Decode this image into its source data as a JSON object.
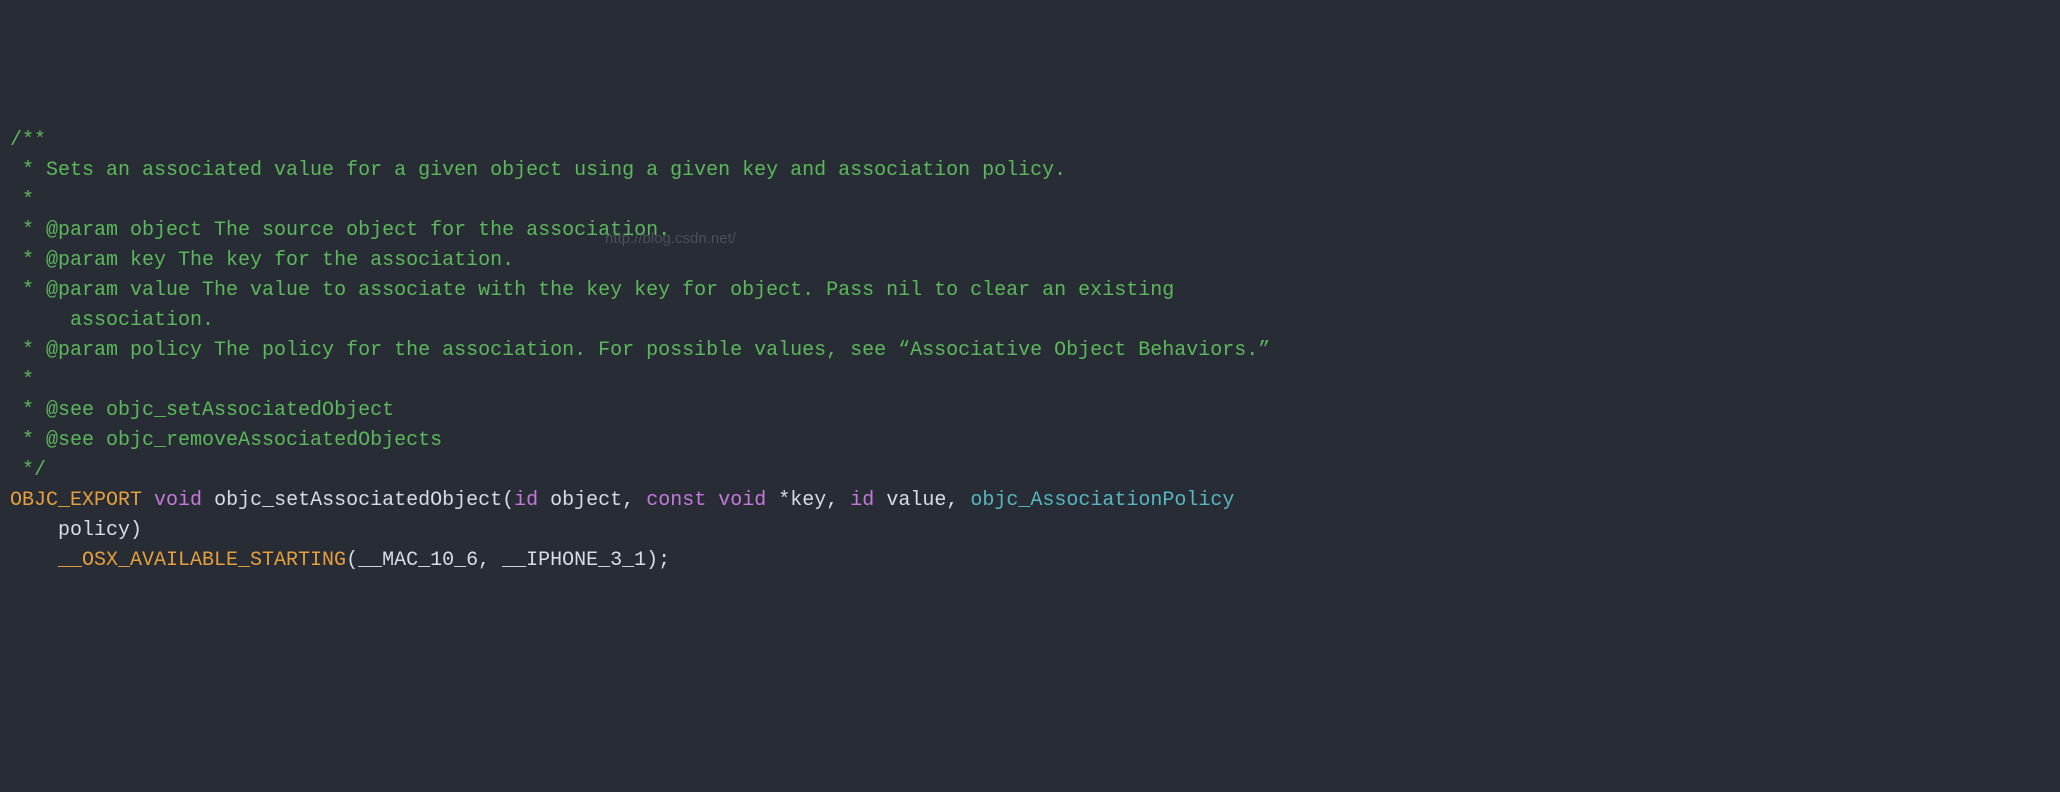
{
  "code": {
    "line1": "/**",
    "line2_prefix": " * ",
    "line2_text": "Sets an associated value for a given object using a given key and association policy.",
    "line3": " *",
    "line4_prefix": " * ",
    "line4_text": "@param object The source object for the association.",
    "line5_prefix": " * ",
    "line5_text": "@param key The key for the association.",
    "line6_prefix": " * ",
    "line6_text": "@param value The value to associate with the key key for object. Pass nil to clear an existing",
    "line7_prefix": "     ",
    "line7_text": "association.",
    "line8_prefix": " * ",
    "line8_text": "@param policy The policy for the association. For possible values, see “Associative Object Behaviors.”",
    "line9": " *",
    "line10_prefix": " * ",
    "line10_text": "@see objc_setAssociatedObject",
    "line11_prefix": " * ",
    "line11_text": "@see objc_removeAssociatedObjects",
    "line12": " */",
    "line13": {
      "macro": "OBJC_EXPORT",
      "void": "void",
      "func": "objc_setAssociatedObject",
      "lparen": "(",
      "p1_type": "id",
      "p1_name": "object",
      "c1": ", ",
      "p2_const": "const",
      "p2_void": "void",
      "p2_star": " *",
      "p2_name": "key",
      "c2": ", ",
      "p3_type": "id",
      "p3_name": "value",
      "c3": ", ",
      "p4_type": "objc_AssociationPolicy",
      "rparen": ""
    },
    "line14_indent": "    ",
    "line14_name": "policy",
    "line14_rparen": ")",
    "line15_indent": "    ",
    "line15_macro": "__OSX_AVAILABLE_STARTING",
    "line15_args": "(__MAC_10_6, __IPHONE_3_1);"
  },
  "watermark": "http://blog.csdn.net/"
}
